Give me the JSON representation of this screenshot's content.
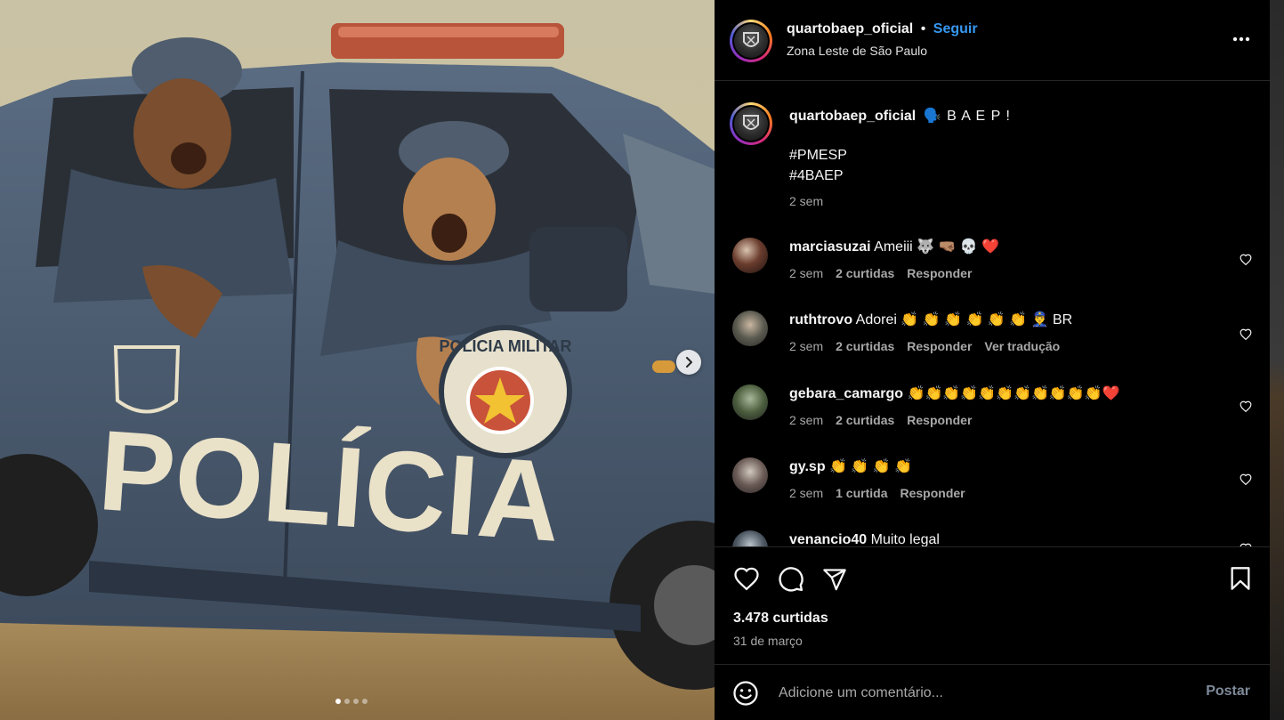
{
  "post": {
    "username": "quartobaep_oficial",
    "separator": "•",
    "follow_label": "Seguir",
    "location": "Zona Leste de São Paulo",
    "more_icon": "more-horizontal-icon"
  },
  "caption": {
    "username": "quartobaep_oficial",
    "text": "🗣️ B A E P !",
    "tag1": "#PMESP",
    "tag2": "#4BAEP",
    "time": "2 sem"
  },
  "comments": [
    {
      "username": "marciasuzai",
      "text": "Ameiii 🐺 🤜🏽 💀 ❤️",
      "time": "2 sem",
      "likes": "2 curtidas",
      "reply": "Responder",
      "translate": ""
    },
    {
      "username": "ruthtrovo",
      "text": "Adorei 👏 👏 👏 👏 👏 👏 👮‍♂️ BR",
      "time": "2 sem",
      "likes": "2 curtidas",
      "reply": "Responder",
      "translate": "Ver tradução"
    },
    {
      "username": "gebara_camargo",
      "text": "👏👏👏👏👏👏👏👏👏👏👏❤️",
      "time": "2 sem",
      "likes": "2 curtidas",
      "reply": "Responder",
      "translate": ""
    },
    {
      "username": "gy.sp",
      "text": "👏 👏 👏 👏",
      "time": "2 sem",
      "likes": "1 curtida",
      "reply": "Responder",
      "translate": ""
    },
    {
      "username": "venancio40",
      "text": "Muito legal",
      "time": "",
      "likes": "",
      "reply": "",
      "translate": ""
    }
  ],
  "media": {
    "door_text": "POLÍCIA",
    "seal_text": "POLICIA MILITAR",
    "carousel_count": 4,
    "carousel_active": 1
  },
  "actions": {
    "likes": "3.478 curtidas",
    "date": "31 de março"
  },
  "add_comment": {
    "placeholder": "Adicione um comentário...",
    "post_label": "Postar"
  },
  "colors": {
    "background": "#000000",
    "accent": "#3797f0",
    "muted": "#a8a8a8"
  }
}
